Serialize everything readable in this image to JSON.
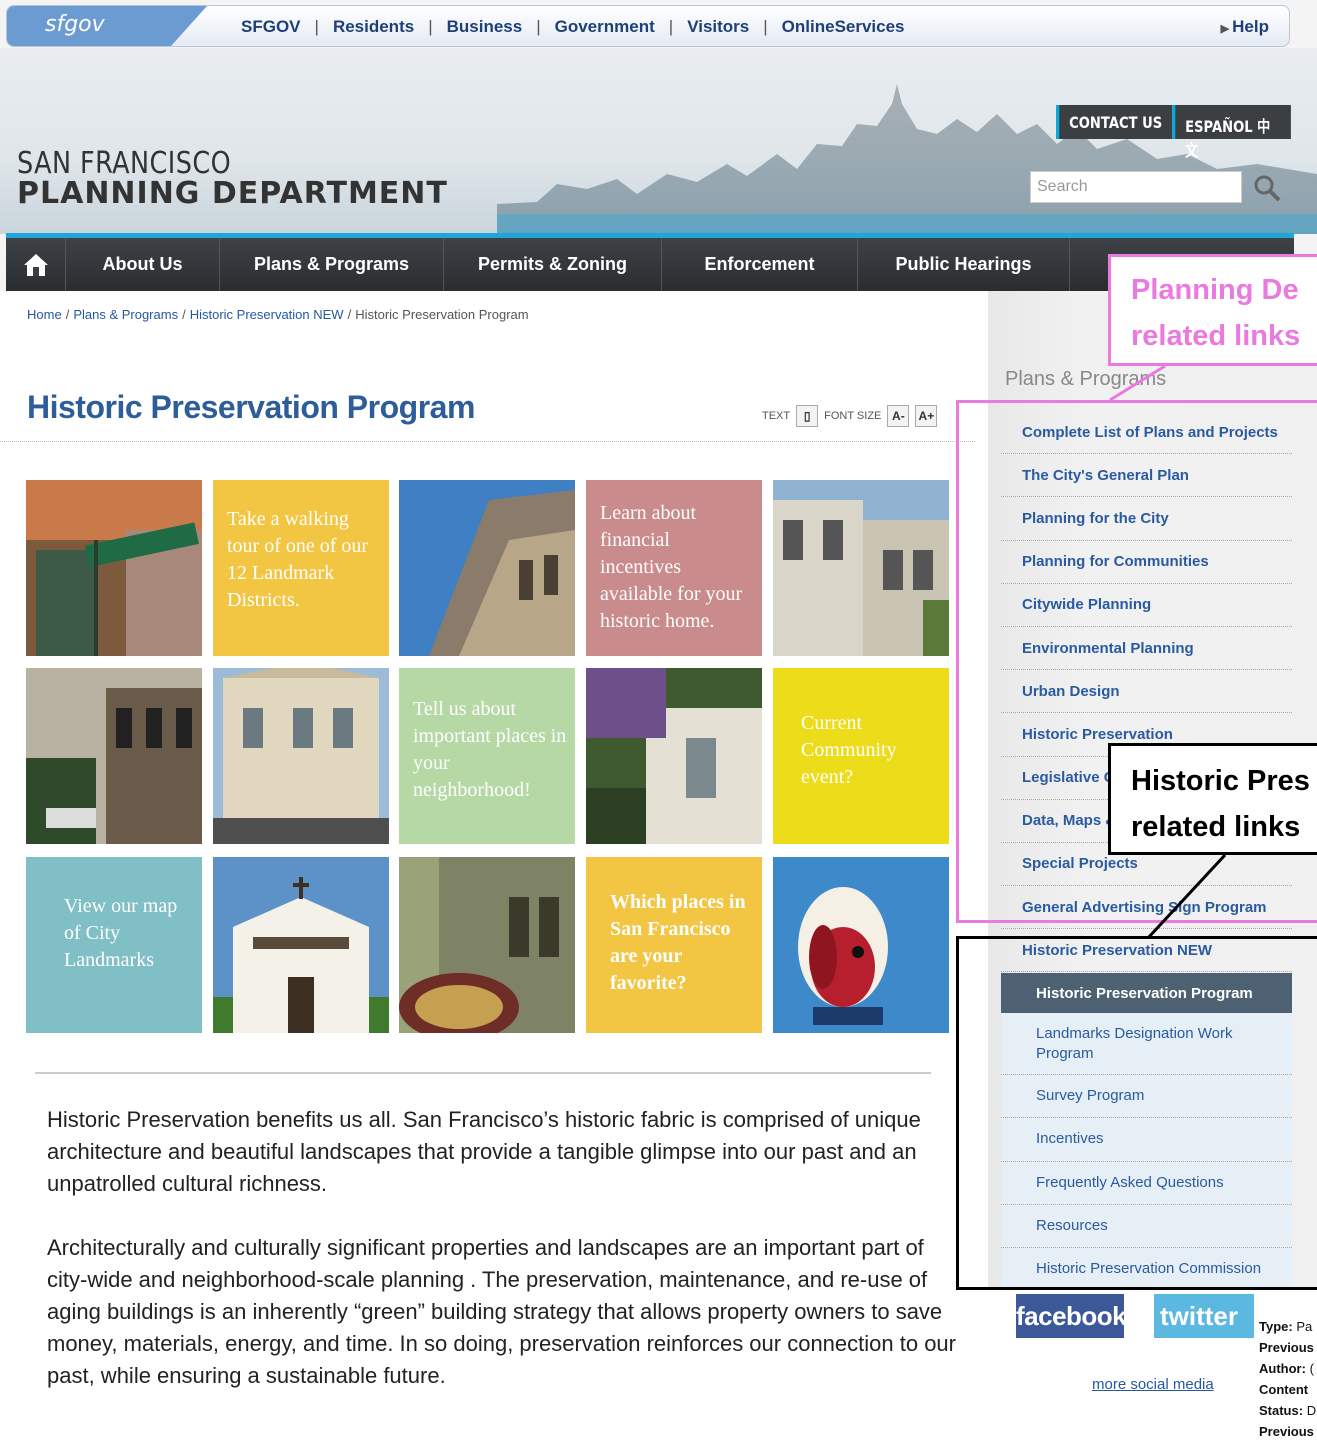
{
  "sfgov": {
    "logo": "sfgov",
    "links": [
      "SFGOV",
      "Residents",
      "Business",
      "Government",
      "Visitors",
      "OnlineServices"
    ],
    "help": "Help"
  },
  "header": {
    "dept_line1": "SAN FRANCISCO",
    "dept_line2": "PLANNING DEPARTMENT",
    "contact": "CONTACT US",
    "lang": "ESPAÑOL  中文",
    "search_placeholder": "Search"
  },
  "nav": {
    "items": [
      "About Us",
      "Plans & Programs",
      "Permits & Zoning",
      "Enforcement",
      "Public Hearings"
    ]
  },
  "breadcrumb": [
    "Home",
    "Plans & Programs",
    "Historic Preservation NEW",
    "Historic Preservation Program"
  ],
  "page": {
    "title": "Historic Preservation Program",
    "text_label": "TEXT",
    "font_size_label": "FONT SIZE",
    "a_minus": "A-",
    "a_plus": "A+"
  },
  "tiles": {
    "walking": "Take a walking tour of one of our 12 Landmark Districts.",
    "financial": "Learn about financial incentives available for your historic home.",
    "tell": "Tell us about important places in your neighborhood!",
    "event": "Current Community event?",
    "map": "View our map of City Landmarks",
    "favorite": "Which places in San Francisco are your favorite?"
  },
  "body": {
    "p1": "Historic Preservation benefits us all.  San Francisco’s historic fabric is comprised of unique architecture and beautiful landscapes that provide a tangible glimpse into our past and an unpatrolled cultural richness.",
    "p2": "Architecturally and culturally significant properties and landscapes are an important part of city-wide and neighborhood-scale planning . The preservation, maintenance, and re-use of aging buildings is an inherently “green” building strategy that allows property owners to save money, materials, energy, and time. In so doing, preservation reinforces our connection to our past, while ensuring a sustainable future."
  },
  "sidebar": {
    "heading": "Plans & Programs",
    "links": [
      "Complete List of Plans and Projects",
      "The City's General Plan",
      "Planning for the City",
      "Planning for Communities",
      "Citywide Planning",
      "Environmental Planning",
      "Urban Design",
      "Historic Preservation",
      "Legislative C",
      "Data, Maps &",
      "Special Projects",
      "General Advertising Sign Program",
      "Historic Preservation NEW"
    ],
    "active": "Historic Preservation Program",
    "sublinks": [
      "Landmarks Designation Work Program",
      "Survey Program",
      "Incentives",
      "Frequently Asked Questions",
      "Resources",
      "Historic Preservation Commission"
    ]
  },
  "annotations": {
    "pink_line1": "Planning De",
    "pink_line2": "related links",
    "black_line1": "Historic Pres",
    "black_line2": "related links"
  },
  "social": {
    "facebook": "facebook",
    "twitter": "twitter",
    "more": "more social media",
    "meta": [
      {
        "k": "Type:",
        "v": "Pa"
      },
      {
        "k": "Previous",
        "v": ""
      },
      {
        "k": "Author:",
        "v": "("
      },
      {
        "k": "Content",
        "v": ""
      },
      {
        "k": "Status:",
        "v": "D"
      },
      {
        "k": "Previous",
        "v": ""
      }
    ]
  },
  "colors": {
    "nav_accent": "#1ea6d8",
    "title_blue": "#2d5e99",
    "yellow_tile": "#f2c543",
    "pink_tile": "#c98b8b",
    "green_tile": "#b5d8a5",
    "bright_yellow_tile": "#ecdc19",
    "teal_tile": "#7fbfc5",
    "annotation_pink": "#ea79e0"
  }
}
